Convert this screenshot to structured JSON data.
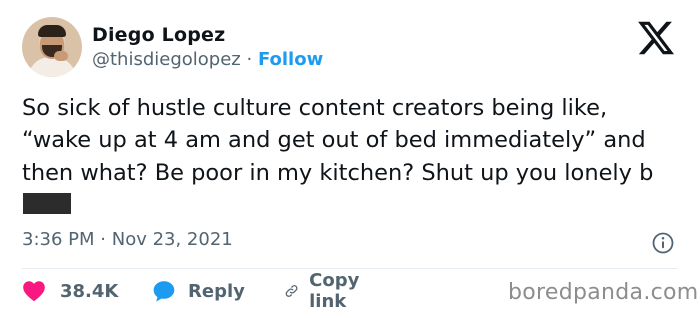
{
  "author": {
    "name": "Diego Lopez",
    "handle": "@thisdiegolopez",
    "separator": "·",
    "follow_label": "Follow"
  },
  "tweet": {
    "text_visible": "So sick of hustle culture content creators being like, “wake up at 4 am and get out of bed immediately” and then what? Be poor in my kitchen? Shut up you lonely b"
  },
  "meta": {
    "time": "3:36 PM",
    "separator": "·",
    "date": "Nov 23, 2021"
  },
  "actions": {
    "likes": "38.4K",
    "reply_label": "Reply",
    "copy_link_label": "Copy link"
  },
  "watermark": "boredpanda.com",
  "colors": {
    "accent": "#1d9bf0",
    "like": "#f91880",
    "text": "#0f1419",
    "secondary": "#536471"
  },
  "icons": {
    "brand": "x-logo-icon",
    "info": "info-icon",
    "like": "heart-icon",
    "reply": "speech-bubble-icon",
    "copy": "link-icon"
  }
}
